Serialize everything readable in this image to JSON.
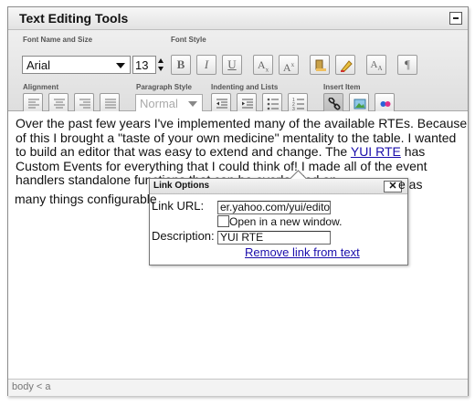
{
  "window": {
    "title": "Text Editing Tools"
  },
  "toolbar": {
    "groups": {
      "font_name_size": "Font Name and Size",
      "font_style": "Font Style",
      "alignment": "Alignment",
      "paragraph_style": "Paragraph Style",
      "indenting_lists": "Indenting and Lists",
      "insert_item": "Insert Item"
    },
    "font_name": "Arial",
    "font_size": "13",
    "paragraph_style_value": "Normal",
    "bold_label": "B",
    "italic_label": "I",
    "underline_label": "U",
    "subscript_label": "Ax",
    "superscript_label": "Ax",
    "pilcrow_label": "¶"
  },
  "editor": {
    "text_before_link": "Over the past few years I've implemented many of the available RTEs. Because of this I brought a \"taste of your own medicine\" mentality to the table. I wanted to build an editor that was easy to extend and change. The ",
    "link_text": "YUI RTE",
    "text_after_link": " has Custom Events for everything that I could think of! I made all of the event handlers standalone functions that can be overloaded on ",
    "text_tail": "e as many things configurable"
  },
  "dialog": {
    "title": "Link Options",
    "close": "✕",
    "link_url_label": "Link URL:",
    "link_url_value": "er.yahoo.com/yui/editor",
    "new_window_label": "Open in a new window.",
    "description_label": "Description:",
    "description_value": "YUI RTE",
    "remove_link": "Remove link from text"
  },
  "status": {
    "path": "body < a"
  }
}
